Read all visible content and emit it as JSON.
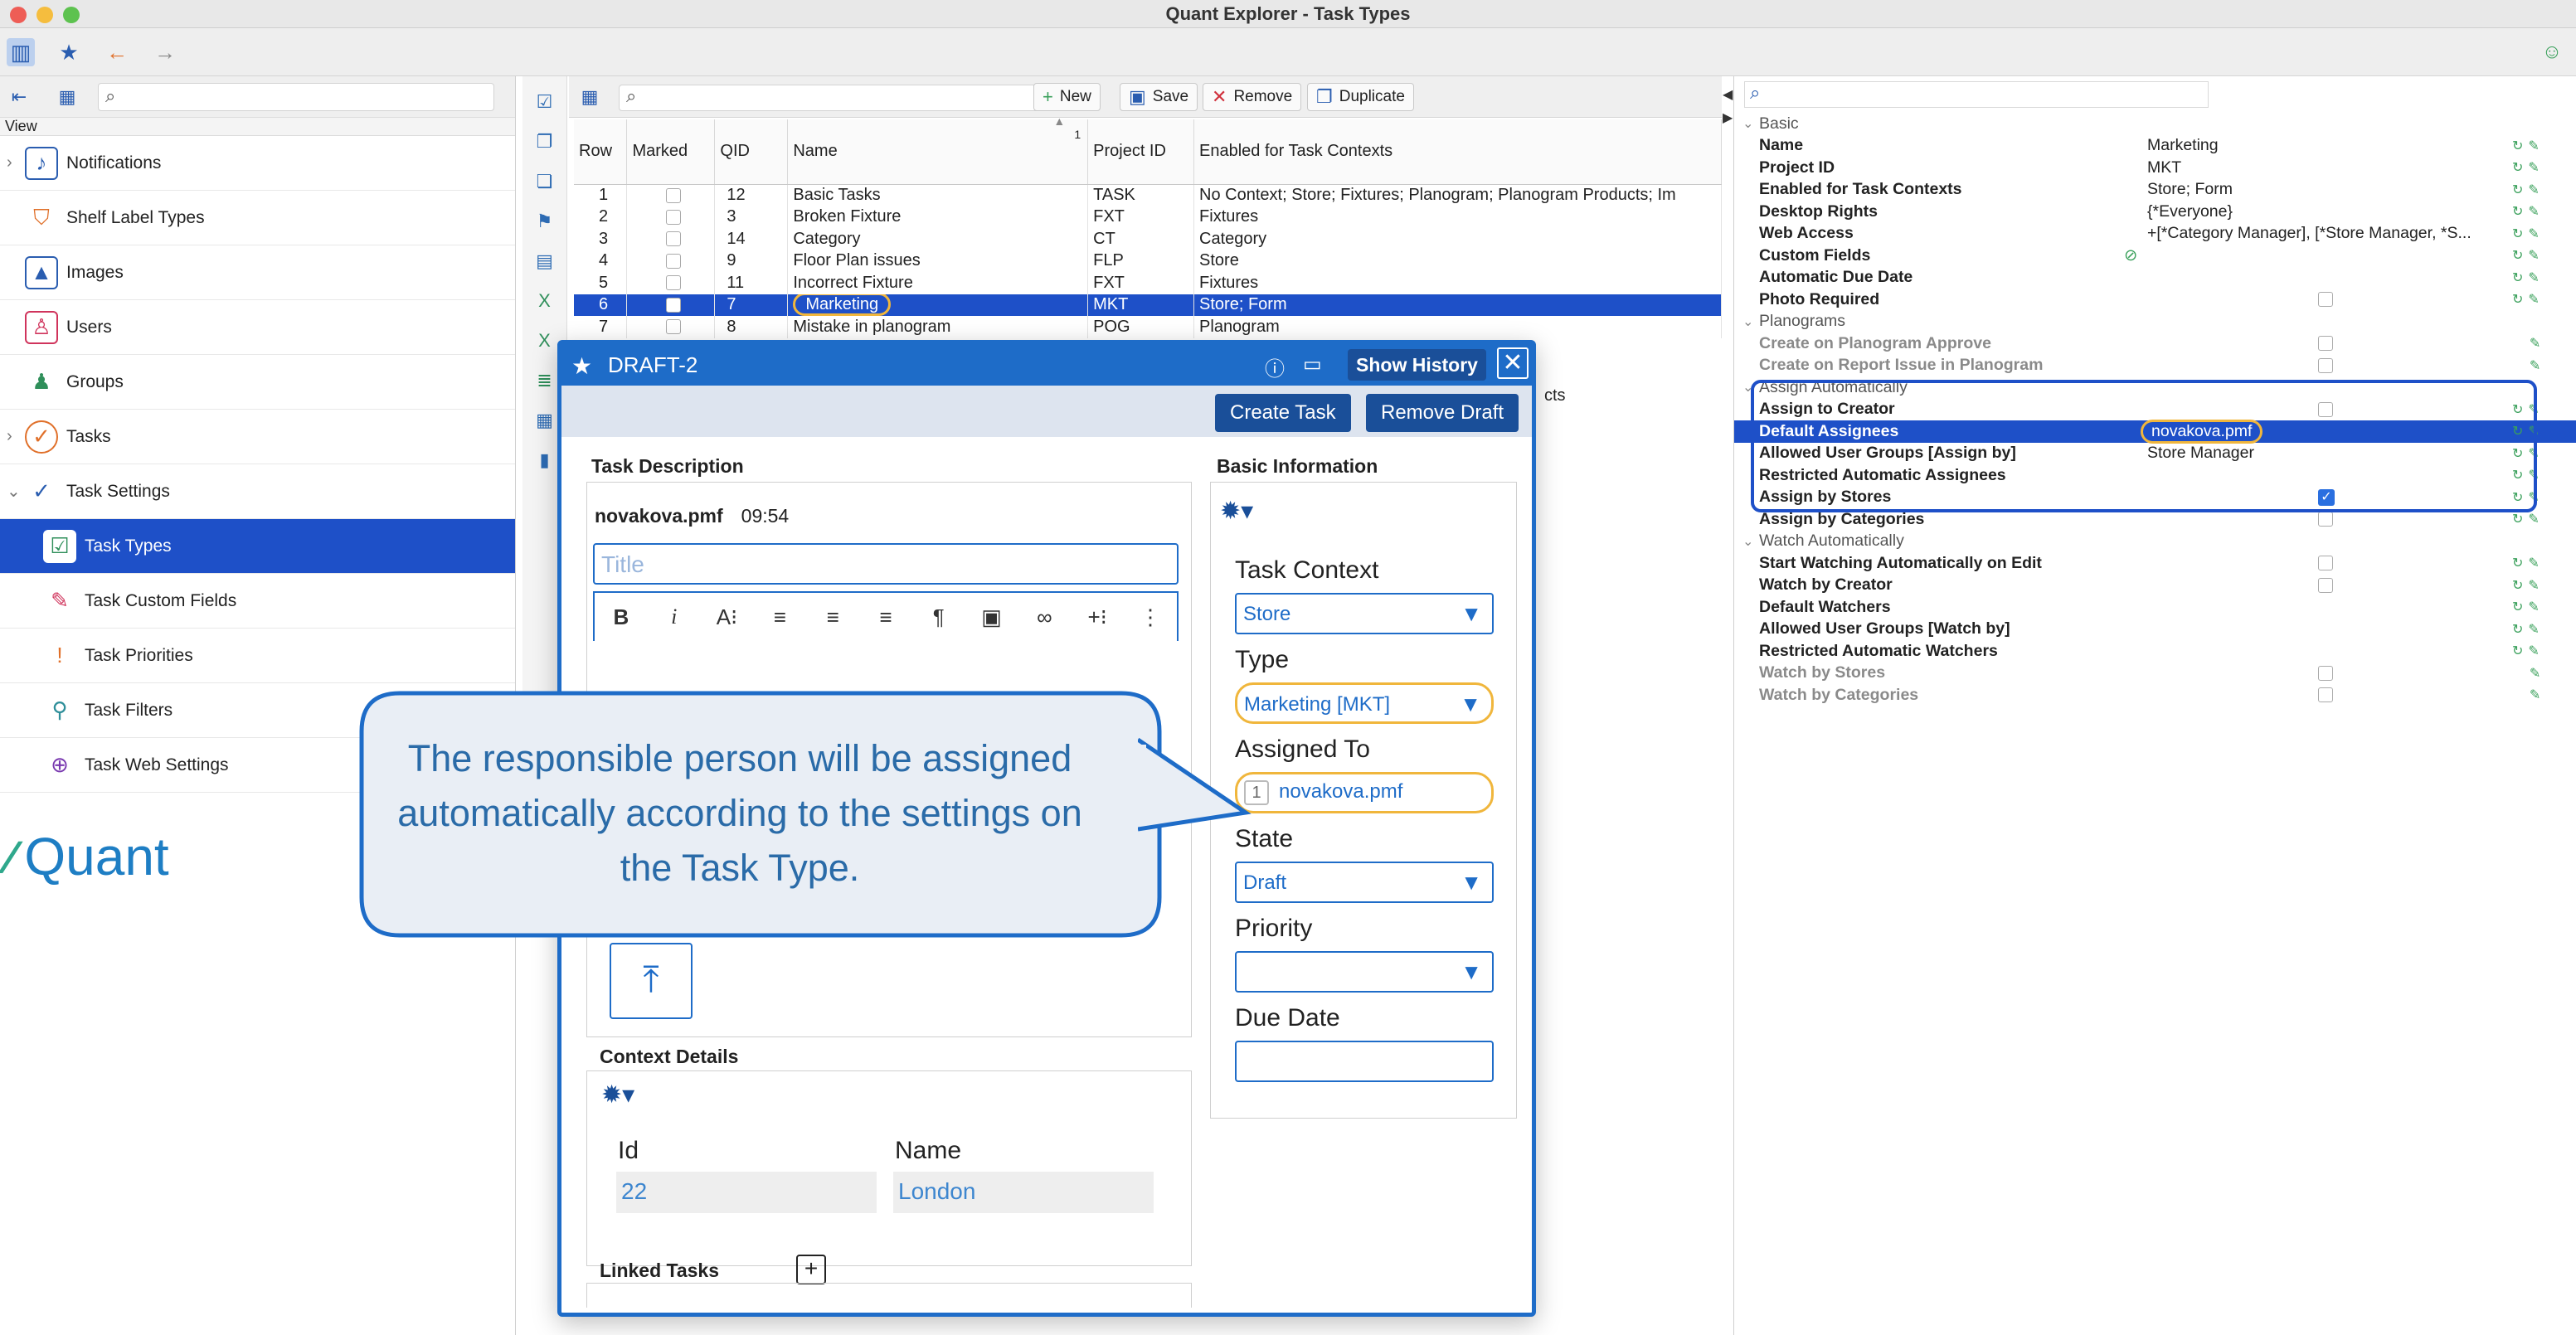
{
  "window": {
    "title": "Quant Explorer - Task Types"
  },
  "sidebar": {
    "view_label": "View",
    "items": [
      {
        "label": "Notifications",
        "icon": "bell-icon",
        "expandable": true
      },
      {
        "label": "Shelf Label Types",
        "icon": "label-icon",
        "expandable": false
      },
      {
        "label": "Images",
        "icon": "image-icon",
        "expandable": false
      },
      {
        "label": "Users",
        "icon": "user-icon",
        "expandable": false
      },
      {
        "label": "Groups",
        "icon": "group-icon",
        "expandable": false
      },
      {
        "label": "Tasks",
        "icon": "task-check-icon",
        "expandable": true
      },
      {
        "label": "Task Settings",
        "icon": "task-settings-icon",
        "expandable": true
      },
      {
        "label": "Task Types",
        "icon": "task-types-icon",
        "selected": true
      },
      {
        "label": "Task Custom Fields",
        "icon": "custom-fields-icon"
      },
      {
        "label": "Task Priorities",
        "icon": "priority-icon"
      },
      {
        "label": "Task Filters",
        "icon": "filter-icon"
      },
      {
        "label": "Task Web Settings",
        "icon": "web-settings-icon"
      }
    ],
    "logo_text": "Quant"
  },
  "table": {
    "buttons": {
      "new": "New",
      "save": "Save",
      "remove": "Remove",
      "duplicate": "Duplicate"
    },
    "sort_indicator": "1",
    "columns": [
      "Row",
      "Marked",
      "QID",
      "Name",
      "Project ID",
      "Enabled for Task Contexts"
    ],
    "rows": [
      {
        "row": "1",
        "qid": "12",
        "name": "Basic Tasks",
        "project": "TASK",
        "contexts": "No Context; Store; Fixtures; Planogram; Planogram Products; Im"
      },
      {
        "row": "2",
        "qid": "3",
        "name": "Broken Fixture",
        "project": "FXT",
        "contexts": "Fixtures"
      },
      {
        "row": "3",
        "qid": "14",
        "name": "Category",
        "project": "CT",
        "contexts": "Category"
      },
      {
        "row": "4",
        "qid": "9",
        "name": "Floor Plan issues",
        "project": "FLP",
        "contexts": "Store"
      },
      {
        "row": "5",
        "qid": "11",
        "name": "Incorrect Fixture",
        "project": "FXT",
        "contexts": "Fixtures"
      },
      {
        "row": "6",
        "qid": "7",
        "name": "Marketing",
        "project": "MKT",
        "contexts": "Store; Form",
        "selected": true
      },
      {
        "row": "7",
        "qid": "8",
        "name": "Mistake in planogram",
        "project": "POG",
        "contexts": "Planogram"
      }
    ],
    "partial_text": "cts"
  },
  "properties": {
    "rows": [
      {
        "type": "group",
        "name": "Basic"
      },
      {
        "name": "Name",
        "value": "Marketing"
      },
      {
        "name": "Project ID",
        "value": "MKT"
      },
      {
        "name": "Enabled for Task Contexts",
        "value": "Store; Form"
      },
      {
        "name": "Desktop Rights",
        "value": "{*Everyone}"
      },
      {
        "name": "Web Access",
        "value": "+[*Category Manager], [*Store Manager, *S..."
      },
      {
        "name": "Custom Fields",
        "value": ""
      },
      {
        "name": "Automatic Due Date",
        "value": ""
      },
      {
        "name": "Photo Required",
        "value": ""
      },
      {
        "type": "group",
        "name": "Planograms"
      },
      {
        "name": "Create on Planogram Approve",
        "value": "",
        "dim": true
      },
      {
        "name": "Create on Report Issue in Planogram",
        "value": "",
        "dim": true
      },
      {
        "type": "group",
        "name": "Assign Automatically"
      },
      {
        "name": "Assign to Creator",
        "value": ""
      },
      {
        "name": "Default Assignees",
        "value": "novakova.pmf",
        "selected": true
      },
      {
        "name": "Allowed User Groups [Assign by]",
        "value": "Store Manager"
      },
      {
        "name": "Restricted Automatic Assignees",
        "value": ""
      },
      {
        "name": "Assign by Stores",
        "value": "",
        "checked": true
      },
      {
        "name": "Assign by Categories",
        "value": ""
      },
      {
        "type": "group",
        "name": "Watch Automatically"
      },
      {
        "name": "Start Watching Automatically on Edit",
        "value": ""
      },
      {
        "name": "Watch by Creator",
        "value": ""
      },
      {
        "name": "Default Watchers",
        "value": ""
      },
      {
        "name": "Allowed User Groups [Watch by]",
        "value": ""
      },
      {
        "name": "Restricted Automatic Watchers",
        "value": ""
      },
      {
        "name": "Watch by Stores",
        "value": "",
        "dim": true
      },
      {
        "name": "Watch by Categories",
        "value": "",
        "dim": true
      }
    ]
  },
  "dialog": {
    "title": "DRAFT-2",
    "show_history": "Show History",
    "create_task": "Create Task",
    "remove_draft": "Remove Draft",
    "task_description": "Task Description",
    "author": "novakova.pmf",
    "time": "09:54",
    "title_placeholder": "Title",
    "context_details": "Context Details",
    "id_label": "Id",
    "id_value": "22",
    "name_label": "Name",
    "name_value": "London",
    "linked_tasks": "Linked Tasks",
    "basic_information": "Basic Information",
    "task_context_label": "Task Context",
    "task_context_value": "Store",
    "type_label": "Type",
    "type_value": "Marketing [MKT]",
    "assigned_to_label": "Assigned To",
    "assigned_to_count": "1",
    "assigned_to_value": "novakova.pmf",
    "state_label": "State",
    "state_value": "Draft",
    "priority_label": "Priority",
    "priority_value": "",
    "due_date_label": "Due Date"
  },
  "callout": {
    "text": "The responsible person will be assigned automatically according to the settings on the Task Type."
  },
  "colors": {
    "accent": "#1e6cc8",
    "selection": "#1e50c8",
    "highlight": "#f0b63c",
    "callout_fill": "#e9eef5"
  }
}
